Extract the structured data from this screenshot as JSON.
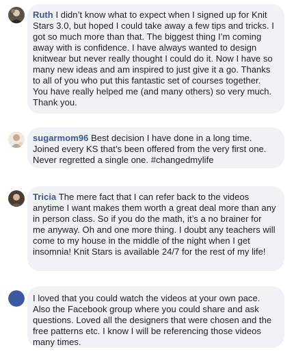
{
  "comments": [
    {
      "author": "Ruth",
      "text": "I didn’t know what to expect when I signed up for Knit Stars 3.0, but hoped I could take away a few tips and tricks. I got so much more than that. The biggest thing I’m coming away with is confidence. I have always wanted to design knitwear but never really thought I could do it. Now I have so many new ideas and am inspired to just give it a go. Thanks to all of you who put this fantastic set of courses together. You have really helped me (and many others) so very much. Thank you.",
      "avatar_icon": "profile-photo-icon"
    },
    {
      "author": "sugarmom96",
      "text": "Best decision I have done in a long time. Joined every KS that’s been offered from the very first one. Never regretted a single one. #changedmylife",
      "avatar_icon": "profile-photo-icon"
    },
    {
      "author": "Tricia",
      "text": "The mere fact that I can refer back to the videos anytime I want makes them worth a great deal more than any in person class. So if you do the math, it’s a no brainer for me anyway. Oh and one more thing. I doubt any teachers will come to my house in the middle of the night when I get insomnia! Knit Stars is available 24/7 for the rest of my life!",
      "avatar_icon": "profile-photo-icon"
    },
    {
      "author": "",
      "text": "I loved that you could watch the videos at your own pace. Also the Facebook group where you could share and ask questions. Loved all the designers that were chosen and the free patterns etc. I know I will be referencing those videos many times.",
      "avatar_icon": "default-avatar-icon"
    }
  ],
  "colors": {
    "bubble_bg": "#f0f2f5",
    "author_name": "#385898",
    "default_avatar": "#3b5aa0"
  }
}
